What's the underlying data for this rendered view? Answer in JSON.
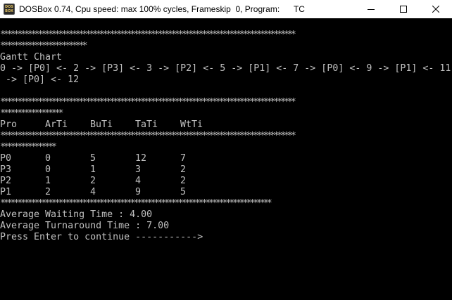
{
  "window": {
    "title": "DOSBox 0.74, Cpu speed: max 100% cycles, Frameskip  0, Program:      TC",
    "icon_text_top": "DOS",
    "icon_text_bottom": "BOX",
    "controls": [
      "minimize-icon",
      "maximize-icon",
      "close-icon"
    ]
  },
  "console": {
    "separator_top_1": "**************************************************************************************",
    "separator_top_2": "*************************",
    "gantt_title": "Gantt Chart",
    "gantt_line_1": "0 -> [P0] <- 2 -> [P3] <- 3 -> [P2] <- 5 -> [P1] <- 7 -> [P0] <- 9 -> [P1] <- 11",
    "gantt_line_2": " -> [P0] <- 12",
    "separator_mid_1": "**************************************************************************************",
    "separator_mid_2": "******************",
    "table_headers": [
      "Pro",
      "ArTi",
      "BuTi",
      "TaTi",
      "WtTi"
    ],
    "separator_table_1": "**************************************************************************************",
    "separator_table_2": "****************",
    "table_rows": [
      [
        "P0",
        "0",
        "5",
        "12",
        "7"
      ],
      [
        "P3",
        "0",
        "1",
        "3",
        "2"
      ],
      [
        "P2",
        "1",
        "2",
        "4",
        "2"
      ],
      [
        "P1",
        "2",
        "4",
        "9",
        "5"
      ]
    ],
    "separator_bottom": "*******************************************************************************",
    "avg_waiting": "Average Waiting Time : 4.00",
    "avg_turnaround": "Average Turnaround Time : 7.00",
    "prompt": "Press Enter to continue ----------->"
  }
}
